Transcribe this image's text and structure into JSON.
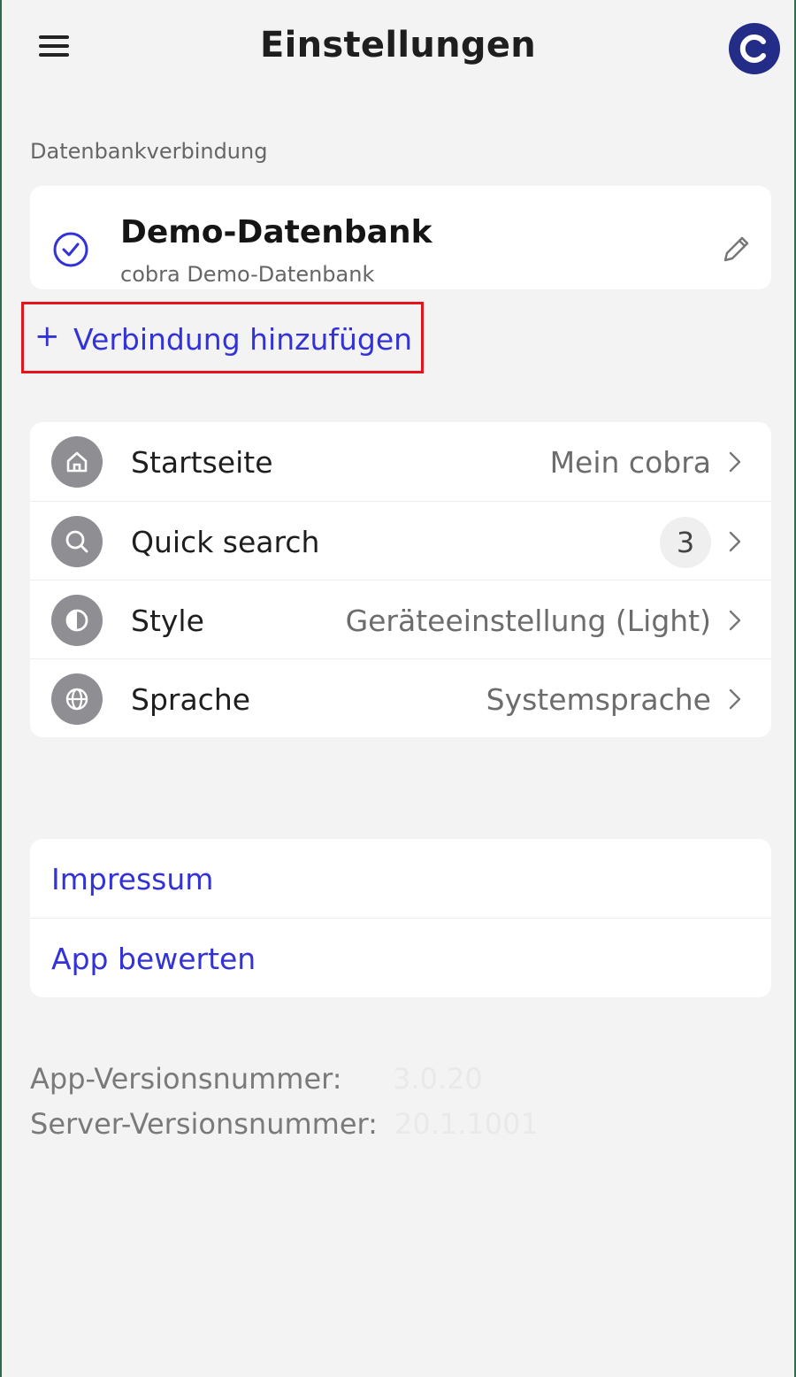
{
  "header": {
    "title": "Einstellungen",
    "menu_icon": "hamburger-menu-icon",
    "avatar_icon": "cobra-logo-icon",
    "avatar_color": "#232c87"
  },
  "connection": {
    "section_label": "Datenbankverbindung",
    "name": "Demo-Datenbank",
    "subtitle": "cobra Demo-Datenbank",
    "add_plus": "+",
    "add_label": "Verbindung hinzufügen",
    "highlight_color": "#e3141a"
  },
  "settings": [
    {
      "label": "Startseite",
      "value": "Mein cobra",
      "icon": "home-icon"
    },
    {
      "label": "Quick search",
      "badge": "3",
      "icon": "search-icon"
    },
    {
      "label": "Style",
      "value": "Geräteeinstellung (Light)",
      "icon": "contrast-icon"
    },
    {
      "label": "Sprache",
      "value": "Systemsprache",
      "icon": "globe-icon"
    }
  ],
  "links": {
    "impressum": "Impressum",
    "rate_app": "App bewerten",
    "color": "#3232d8"
  },
  "versions": {
    "app_label": "App-Versionsnummer:",
    "app_value": "3.0.20",
    "server_label": "Server-Versionsnummer:",
    "server_value": "20.1.1001"
  }
}
